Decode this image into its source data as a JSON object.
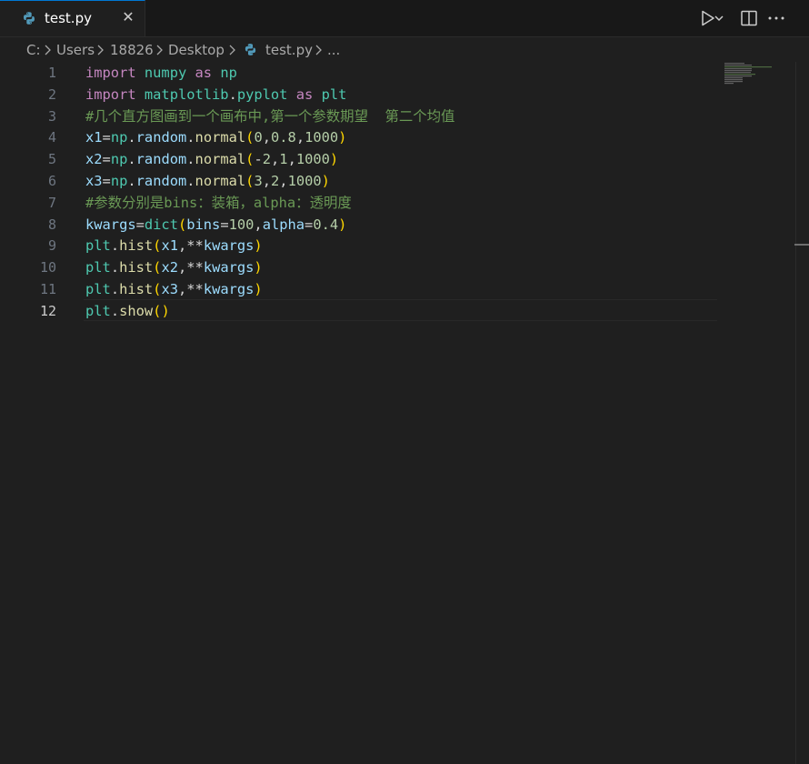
{
  "tab": {
    "filename": "test.py",
    "close_glyph": "✕"
  },
  "actions": {
    "run_icon": "play-icon",
    "dropdown_icon": "chevron-down-icon",
    "split_icon": "split-editor-icon",
    "more_icon": "more-icon"
  },
  "breadcrumb": {
    "items": [
      "C:",
      "Users",
      "18826",
      "Desktop",
      "test.py",
      "..."
    ]
  },
  "editor": {
    "active_line": 12,
    "line_numbers": [
      "1",
      "2",
      "3",
      "4",
      "5",
      "6",
      "7",
      "8",
      "9",
      "10",
      "11",
      "12"
    ],
    "lines": [
      [
        [
          "kw",
          "import"
        ],
        [
          "op",
          " "
        ],
        [
          "mod",
          "numpy"
        ],
        [
          "op",
          " "
        ],
        [
          "kw",
          "as"
        ],
        [
          "op",
          " "
        ],
        [
          "mod",
          "np"
        ]
      ],
      [
        [
          "kw",
          "import"
        ],
        [
          "op",
          " "
        ],
        [
          "mod",
          "matplotlib"
        ],
        [
          "op",
          "."
        ],
        [
          "mod",
          "pyplot"
        ],
        [
          "op",
          " "
        ],
        [
          "kw",
          "as"
        ],
        [
          "op",
          " "
        ],
        [
          "mod",
          "plt"
        ]
      ],
      [
        [
          "cm",
          "#几个直方图画到一个画布中,第一个参数期望  第二个均值"
        ]
      ],
      [
        [
          "var",
          "x1"
        ],
        [
          "op",
          "="
        ],
        [
          "mod",
          "np"
        ],
        [
          "op",
          "."
        ],
        [
          "var",
          "random"
        ],
        [
          "op",
          "."
        ],
        [
          "fn",
          "normal"
        ],
        [
          "p1",
          "("
        ],
        [
          "num",
          "0"
        ],
        [
          "op",
          ","
        ],
        [
          "num",
          "0.8"
        ],
        [
          "op",
          ","
        ],
        [
          "num",
          "1000"
        ],
        [
          "p1",
          ")"
        ]
      ],
      [
        [
          "var",
          "x2"
        ],
        [
          "op",
          "="
        ],
        [
          "mod",
          "np"
        ],
        [
          "op",
          "."
        ],
        [
          "var",
          "random"
        ],
        [
          "op",
          "."
        ],
        [
          "fn",
          "normal"
        ],
        [
          "p1",
          "("
        ],
        [
          "op",
          "-"
        ],
        [
          "num",
          "2"
        ],
        [
          "op",
          ","
        ],
        [
          "num",
          "1"
        ],
        [
          "op",
          ","
        ],
        [
          "num",
          "1000"
        ],
        [
          "p1",
          ")"
        ]
      ],
      [
        [
          "var",
          "x3"
        ],
        [
          "op",
          "="
        ],
        [
          "mod",
          "np"
        ],
        [
          "op",
          "."
        ],
        [
          "var",
          "random"
        ],
        [
          "op",
          "."
        ],
        [
          "fn",
          "normal"
        ],
        [
          "p1",
          "("
        ],
        [
          "num",
          "3"
        ],
        [
          "op",
          ","
        ],
        [
          "num",
          "2"
        ],
        [
          "op",
          ","
        ],
        [
          "num",
          "1000"
        ],
        [
          "p1",
          ")"
        ]
      ],
      [
        [
          "cm",
          "#参数分别是bins：装箱，alpha：透明度"
        ]
      ],
      [
        [
          "var",
          "kwargs"
        ],
        [
          "op",
          "="
        ],
        [
          "mod",
          "dict"
        ],
        [
          "p1",
          "("
        ],
        [
          "var",
          "bins"
        ],
        [
          "op",
          "="
        ],
        [
          "num",
          "100"
        ],
        [
          "op",
          ","
        ],
        [
          "var",
          "alpha"
        ],
        [
          "op",
          "="
        ],
        [
          "num",
          "0.4"
        ],
        [
          "p1",
          ")"
        ]
      ],
      [
        [
          "mod",
          "plt"
        ],
        [
          "op",
          "."
        ],
        [
          "fn",
          "hist"
        ],
        [
          "p1",
          "("
        ],
        [
          "var",
          "x1"
        ],
        [
          "op",
          ",**"
        ],
        [
          "var",
          "kwargs"
        ],
        [
          "p1",
          ")"
        ]
      ],
      [
        [
          "mod",
          "plt"
        ],
        [
          "op",
          "."
        ],
        [
          "fn",
          "hist"
        ],
        [
          "p1",
          "("
        ],
        [
          "var",
          "x2"
        ],
        [
          "op",
          ",**"
        ],
        [
          "var",
          "kwargs"
        ],
        [
          "p1",
          ")"
        ]
      ],
      [
        [
          "mod",
          "plt"
        ],
        [
          "op",
          "."
        ],
        [
          "fn",
          "hist"
        ],
        [
          "p1",
          "("
        ],
        [
          "var",
          "x3"
        ],
        [
          "op",
          ",**"
        ],
        [
          "var",
          "kwargs"
        ],
        [
          "p1",
          ")"
        ]
      ],
      [
        [
          "mod",
          "plt"
        ],
        [
          "op",
          "."
        ],
        [
          "fn",
          "show"
        ],
        [
          "p1",
          "()"
        ]
      ]
    ]
  },
  "colors": {
    "background": "#1f1f1f",
    "tabbar": "#181818",
    "keyword": "#c586c0",
    "module": "#4ec9b0",
    "variable": "#9cdcfe",
    "function": "#dcdcaa",
    "number": "#b5cea8",
    "comment": "#6a9955",
    "bracket": "#ffd700",
    "python_icon_blue": "#519aba"
  }
}
